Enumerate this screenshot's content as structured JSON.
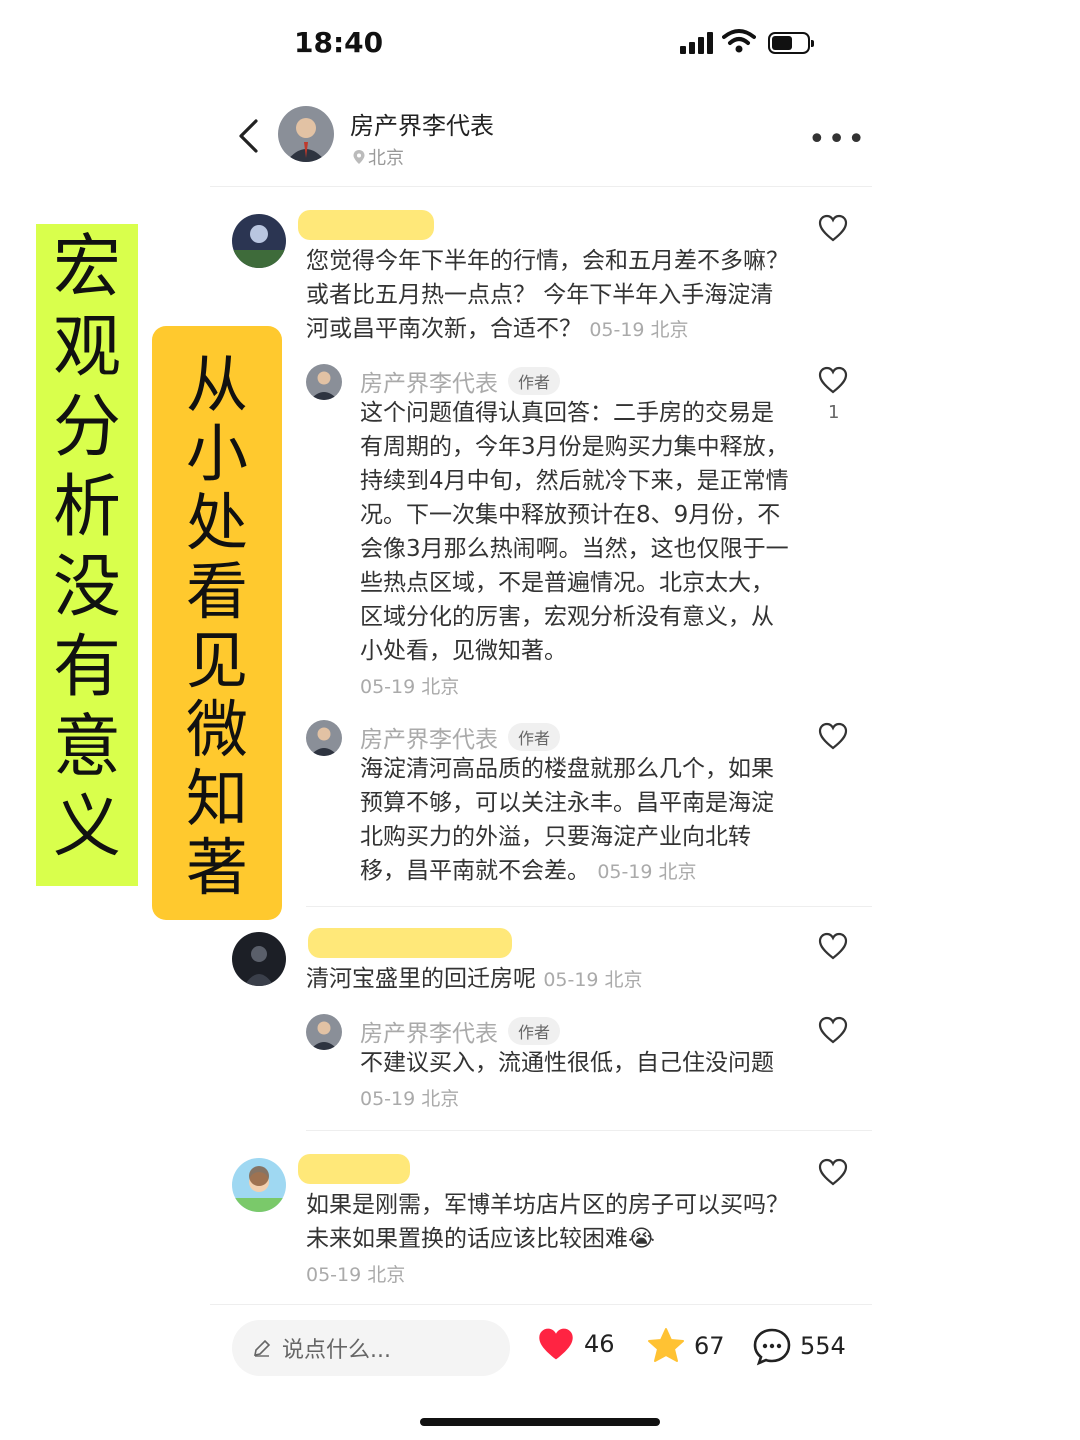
{
  "status_bar": {
    "time": "18:40"
  },
  "header": {
    "name": "房产界李代表",
    "location": "北京"
  },
  "banners": {
    "green": [
      "宏",
      "观",
      "分",
      "析",
      "没",
      "有",
      "意",
      "义"
    ],
    "orange": [
      "从",
      "小",
      "处",
      "看",
      "见",
      "微",
      "知",
      "著"
    ]
  },
  "comments": [
    {
      "text": "您觉得今年下半年的行情，会和五月差不多嘛？或者比五月热一点点？ 今年下半年入手海淀清河或昌平南次新，合适不？",
      "meta": "05-19 北京",
      "replies": [
        {
          "name": "房产界李代表",
          "tag": "作者",
          "text": "这个问题值得认真回答：二手房的交易是有周期的，今年3月份是购买力集中释放，持续到4月中旬，然后就冷下来，是正常情况。下一次集中释放预计在8、9月份，不会像3月那么热闹啊。当然，这也仅限于一些热点区域，不是普遍情况。北京太大，区域分化的厉害，宏观分析没有意义，从小处看，见微知著。",
          "meta": "05-19 北京",
          "likes": "1"
        },
        {
          "name": "房产界李代表",
          "tag": "作者",
          "text": "海淀清河高品质的楼盘就那么几个，如果预算不够，可以关注永丰。昌平南是海淀北购买力的外溢，只要海淀产业向北转移，昌平南就不会差。",
          "meta": "05-19 北京"
        }
      ]
    },
    {
      "text": "清河宝盛里的回迁房呢",
      "meta": "05-19 北京",
      "replies": [
        {
          "name": "房产界李代表",
          "tag": "作者",
          "text": "不建议买入，流通性很低，自己住没问题",
          "meta": "05-19 北京"
        }
      ]
    },
    {
      "text": "如果是刚需，军博羊坊店片区的房子可以买吗？未来如果置换的话应该比较困难",
      "emoji": "😭",
      "meta": "05-19 北京"
    }
  ],
  "bottom_bar": {
    "placeholder": "说点什么...",
    "likes": "46",
    "favorites": "67",
    "comments": "554"
  },
  "colors": {
    "like": "#ff2442",
    "star": "#ffc233",
    "banner_green": "#d9ff4c",
    "banner_orange": "#ffc92e"
  }
}
